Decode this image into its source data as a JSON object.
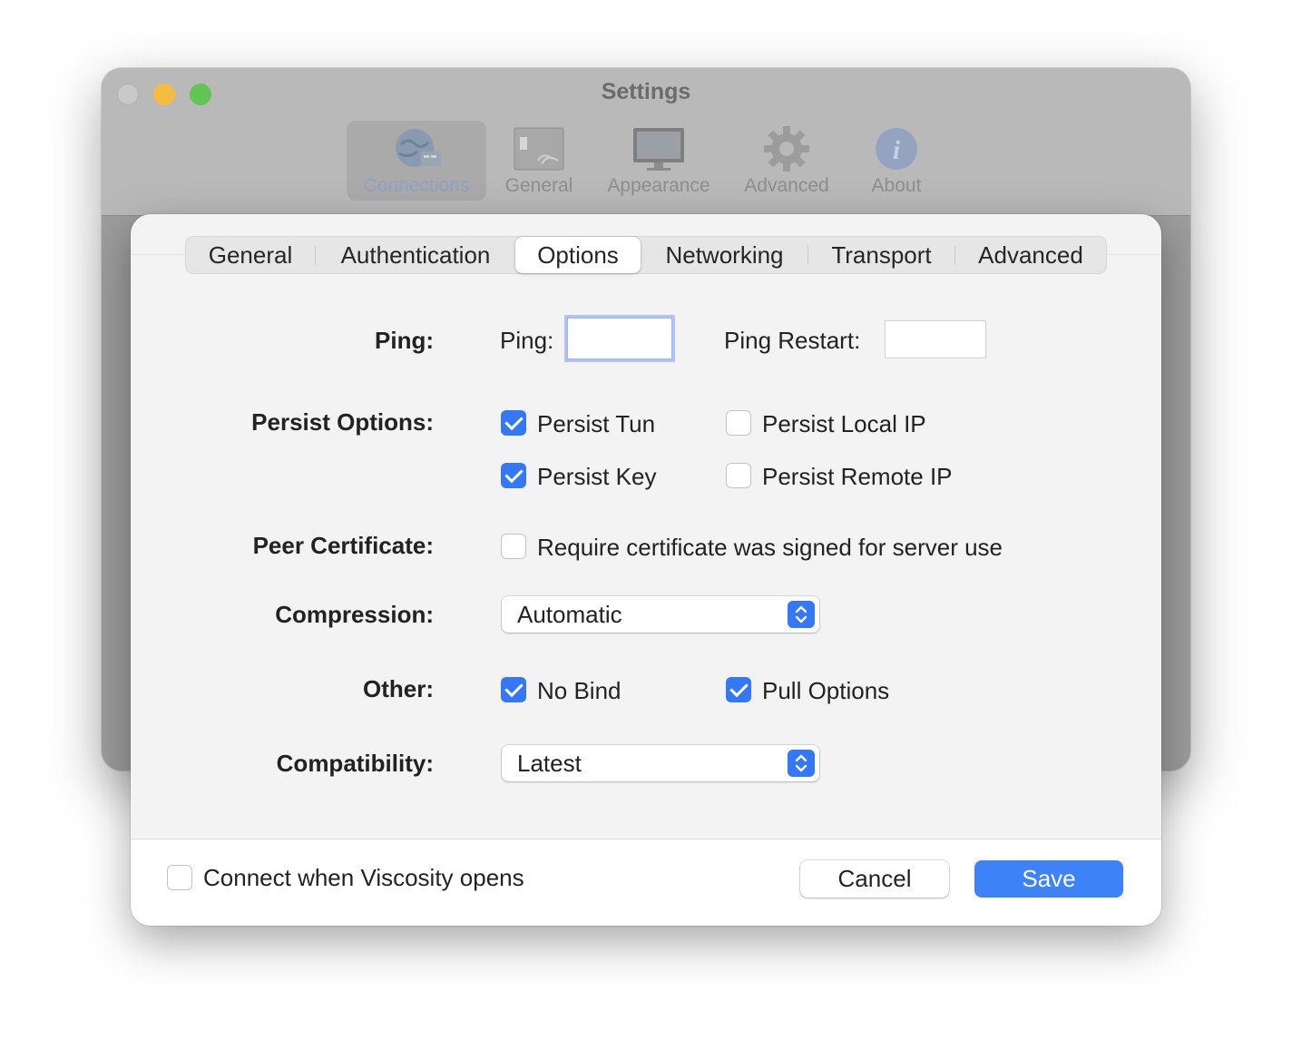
{
  "window": {
    "title": "Settings",
    "toolbar": [
      {
        "label": "Connections",
        "icon": "globe-connections-icon",
        "active": true
      },
      {
        "label": "General",
        "icon": "switch-panel-icon",
        "active": false
      },
      {
        "label": "Appearance",
        "icon": "display-icon",
        "active": false
      },
      {
        "label": "Advanced",
        "icon": "gear-icon",
        "active": false
      },
      {
        "label": "About",
        "icon": "info-icon",
        "active": false
      }
    ]
  },
  "tabs": [
    {
      "label": "General",
      "active": false
    },
    {
      "label": "Authentication",
      "active": false
    },
    {
      "label": "Options",
      "active": true
    },
    {
      "label": "Networking",
      "active": false
    },
    {
      "label": "Transport",
      "active": false
    },
    {
      "label": "Advanced",
      "active": false
    }
  ],
  "form": {
    "ping": {
      "label": "Ping:",
      "ping_label": "Ping:",
      "ping_value": "",
      "restart_label": "Ping Restart:",
      "restart_value": ""
    },
    "persist": {
      "label": "Persist Options:",
      "items": [
        {
          "label": "Persist Tun",
          "checked": true
        },
        {
          "label": "Persist Local IP",
          "checked": false
        },
        {
          "label": "Persist Key",
          "checked": true
        },
        {
          "label": "Persist Remote IP",
          "checked": false
        }
      ]
    },
    "peer_certificate": {
      "label": "Peer Certificate:",
      "option": {
        "label": "Require certificate was signed for server use",
        "checked": false
      }
    },
    "compression": {
      "label": "Compression:",
      "value": "Automatic"
    },
    "other": {
      "label": "Other:",
      "items": [
        {
          "label": "No Bind",
          "checked": true
        },
        {
          "label": "Pull Options",
          "checked": true
        }
      ]
    },
    "compatibility": {
      "label": "Compatibility:",
      "value": "Latest"
    }
  },
  "footer": {
    "connect_on_open": {
      "label": "Connect when Viscosity opens",
      "checked": false
    },
    "cancel_label": "Cancel",
    "save_label": "Save"
  },
  "colors": {
    "accent": "#3478f6",
    "save_button": "#3d82f7"
  }
}
